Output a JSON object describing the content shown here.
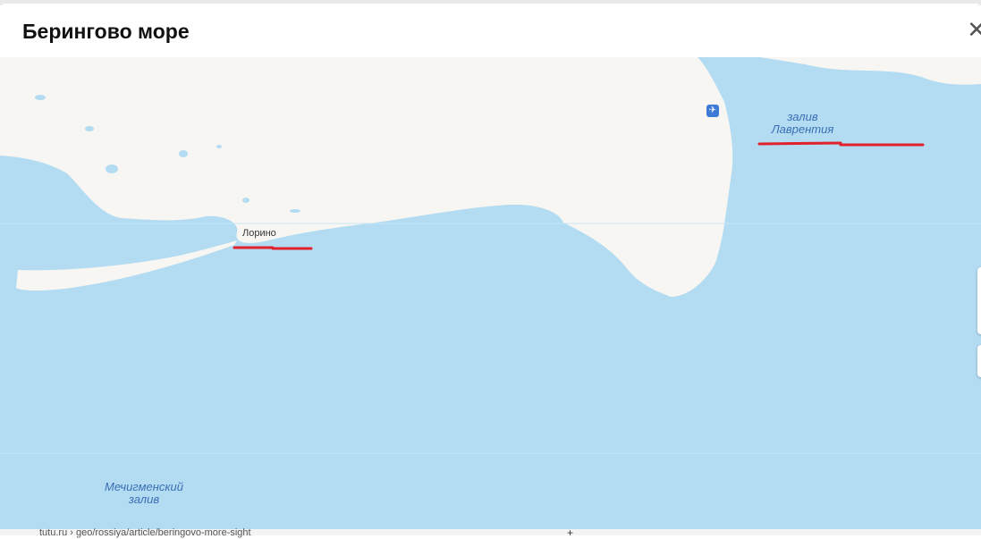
{
  "dialog": {
    "title": "Берингово море",
    "close_icon": "close-icon"
  },
  "map": {
    "labels": {
      "bay_lavrentiya_line1": "залив",
      "bay_lavrentiya_line2": "Лаврентия",
      "town_lorino": "Лорино",
      "bay_mechigmen_line1": "Мечигменский",
      "bay_mechigmen_line2": "залив"
    },
    "icons": {
      "airport": "airport-icon"
    },
    "colors": {
      "sea": "#b3dcf2",
      "land": "#f7f6f2",
      "highlight": "#e0202a",
      "label": "#3a6fb5"
    }
  },
  "footer": {
    "url_text": "tutu.ru › geo/rossiya/article/beringovo-more-sight",
    "plus": "+"
  }
}
